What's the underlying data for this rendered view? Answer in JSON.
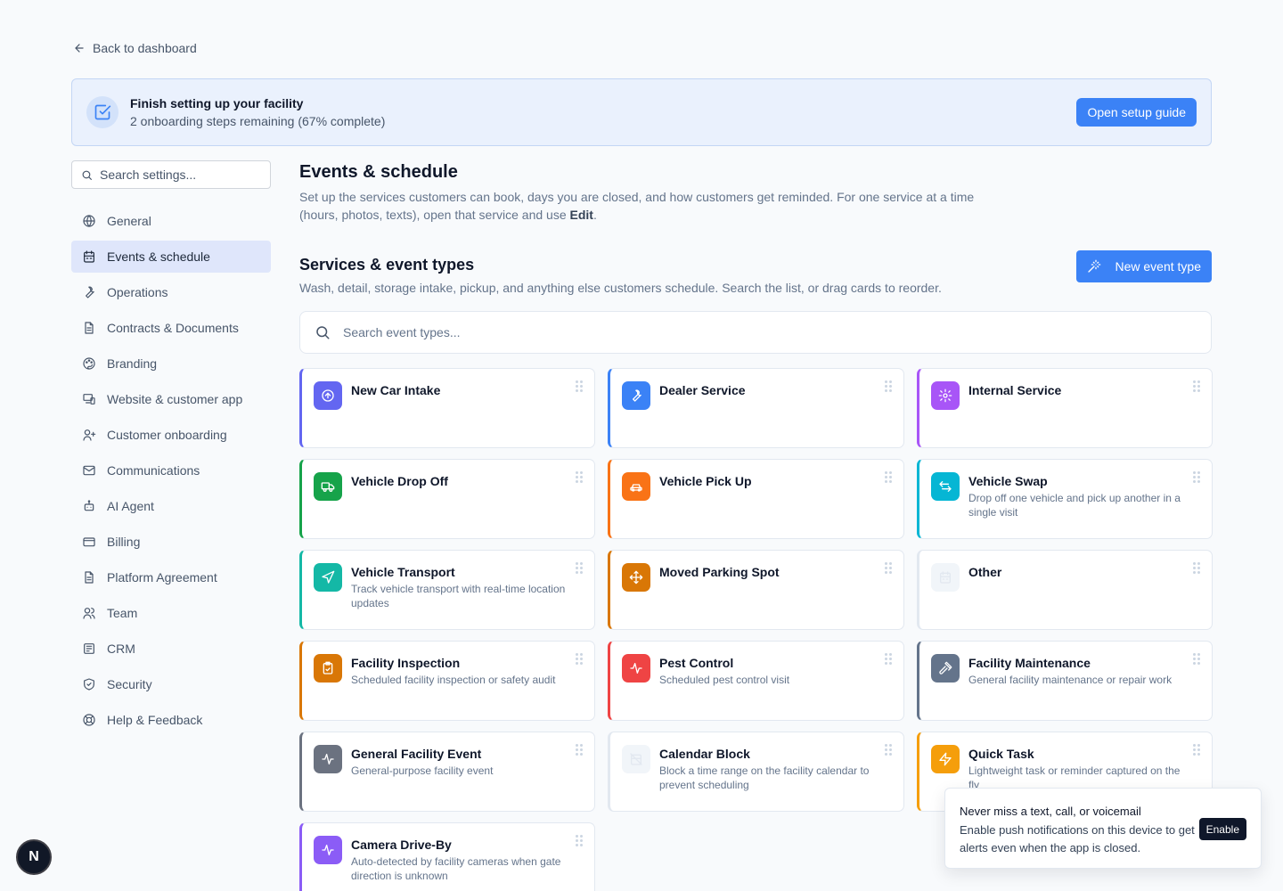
{
  "back_link": "Back to dashboard",
  "setup_banner": {
    "title": "Finish setting up your facility",
    "subtitle": "2 onboarding steps remaining (67% complete)",
    "button": "Open setup guide",
    "progress_percent": 67
  },
  "sidebar": {
    "search_placeholder": "Search settings...",
    "items": [
      {
        "label": "General",
        "icon": "globe-icon"
      },
      {
        "label": "Events & schedule",
        "icon": "calendar-icon",
        "active": true
      },
      {
        "label": "Operations",
        "icon": "wrench-icon"
      },
      {
        "label": "Contracts & Documents",
        "icon": "document-icon"
      },
      {
        "label": "Branding",
        "icon": "palette-icon"
      },
      {
        "label": "Website & customer app",
        "icon": "devices-icon"
      },
      {
        "label": "Customer onboarding",
        "icon": "user-plus-icon"
      },
      {
        "label": "Communications",
        "icon": "mail-icon"
      },
      {
        "label": "AI Agent",
        "icon": "bot-icon"
      },
      {
        "label": "Billing",
        "icon": "credit-card-icon"
      },
      {
        "label": "Platform Agreement",
        "icon": "document-icon"
      },
      {
        "label": "Team",
        "icon": "users-icon"
      },
      {
        "label": "CRM",
        "icon": "contact-card-icon"
      },
      {
        "label": "Security",
        "icon": "shield-icon"
      },
      {
        "label": "Help & Feedback",
        "icon": "lifebuoy-icon"
      }
    ]
  },
  "main": {
    "title": "Events & schedule",
    "description_prefix": "Set up the services customers can book, days you are closed, and how customers get reminded. For one service at a time (hours, photos, texts), open that service and use ",
    "description_bold": "Edit",
    "description_suffix": ".",
    "section_title": "Services & event types",
    "section_desc": "Wash, detail, storage intake, pickup, and anything else customers schedule. Search the list, or drag cards to reorder.",
    "new_button": "New event type",
    "search_placeholder": "Search event types..."
  },
  "event_types": [
    {
      "title": "New Car Intake",
      "desc": "",
      "color": "#6366f1",
      "icon": "arrow-up-circle-icon"
    },
    {
      "title": "Dealer Service",
      "desc": "",
      "color": "#3b82f6",
      "icon": "wrench-icon"
    },
    {
      "title": "Internal Service",
      "desc": "",
      "color": "#a855f7",
      "icon": "gear-icon"
    },
    {
      "title": "Vehicle Drop Off",
      "desc": "",
      "color": "#16a34a",
      "icon": "truck-icon"
    },
    {
      "title": "Vehicle Pick Up",
      "desc": "",
      "color": "#f97316",
      "icon": "car-icon"
    },
    {
      "title": "Vehicle Swap",
      "desc": "Drop off one vehicle and pick up another in a single visit",
      "color": "#06b6d4",
      "icon": "swap-icon"
    },
    {
      "title": "Vehicle Transport",
      "desc": "Track vehicle transport with real-time location updates",
      "color": "#14b8a6",
      "icon": "navigation-icon"
    },
    {
      "title": "Moved Parking Spot",
      "desc": "",
      "color": "#d97706",
      "icon": "move-icon"
    },
    {
      "title": "Other",
      "desc": "",
      "color": "#e2e8f0",
      "icon": "calendar-icon"
    },
    {
      "title": "Facility Inspection",
      "desc": "Scheduled facility inspection or safety audit",
      "color": "#d97706",
      "icon": "clipboard-check-icon"
    },
    {
      "title": "Pest Control",
      "desc": "Scheduled pest control visit",
      "color": "#ef4444",
      "icon": "activity-icon"
    },
    {
      "title": "Facility Maintenance",
      "desc": "General facility maintenance or repair work",
      "color": "#64748b",
      "icon": "hammer-icon"
    },
    {
      "title": "General Facility Event",
      "desc": "General-purpose facility event",
      "color": "#6b7280",
      "icon": "activity-icon"
    },
    {
      "title": "Calendar Block",
      "desc": "Block a time range on the facility calendar to prevent scheduling",
      "color": "#e2e8f0",
      "icon": "calendar-off-icon"
    },
    {
      "title": "Quick Task",
      "desc": "Lightweight task or reminder captured on the fly",
      "color": "#f59e0b",
      "icon": "zap-icon"
    },
    {
      "title": "Camera Drive-By",
      "desc": "Auto-detected by facility cameras when gate direction is unknown",
      "color": "#8b5cf6",
      "icon": "activity-icon"
    }
  ],
  "toast": {
    "title": "Never miss a text, call, or voicemail",
    "body": "Enable push notifications on this device to get alerts even when the app is closed.",
    "button": "Enable"
  },
  "avatar_letter": "N"
}
